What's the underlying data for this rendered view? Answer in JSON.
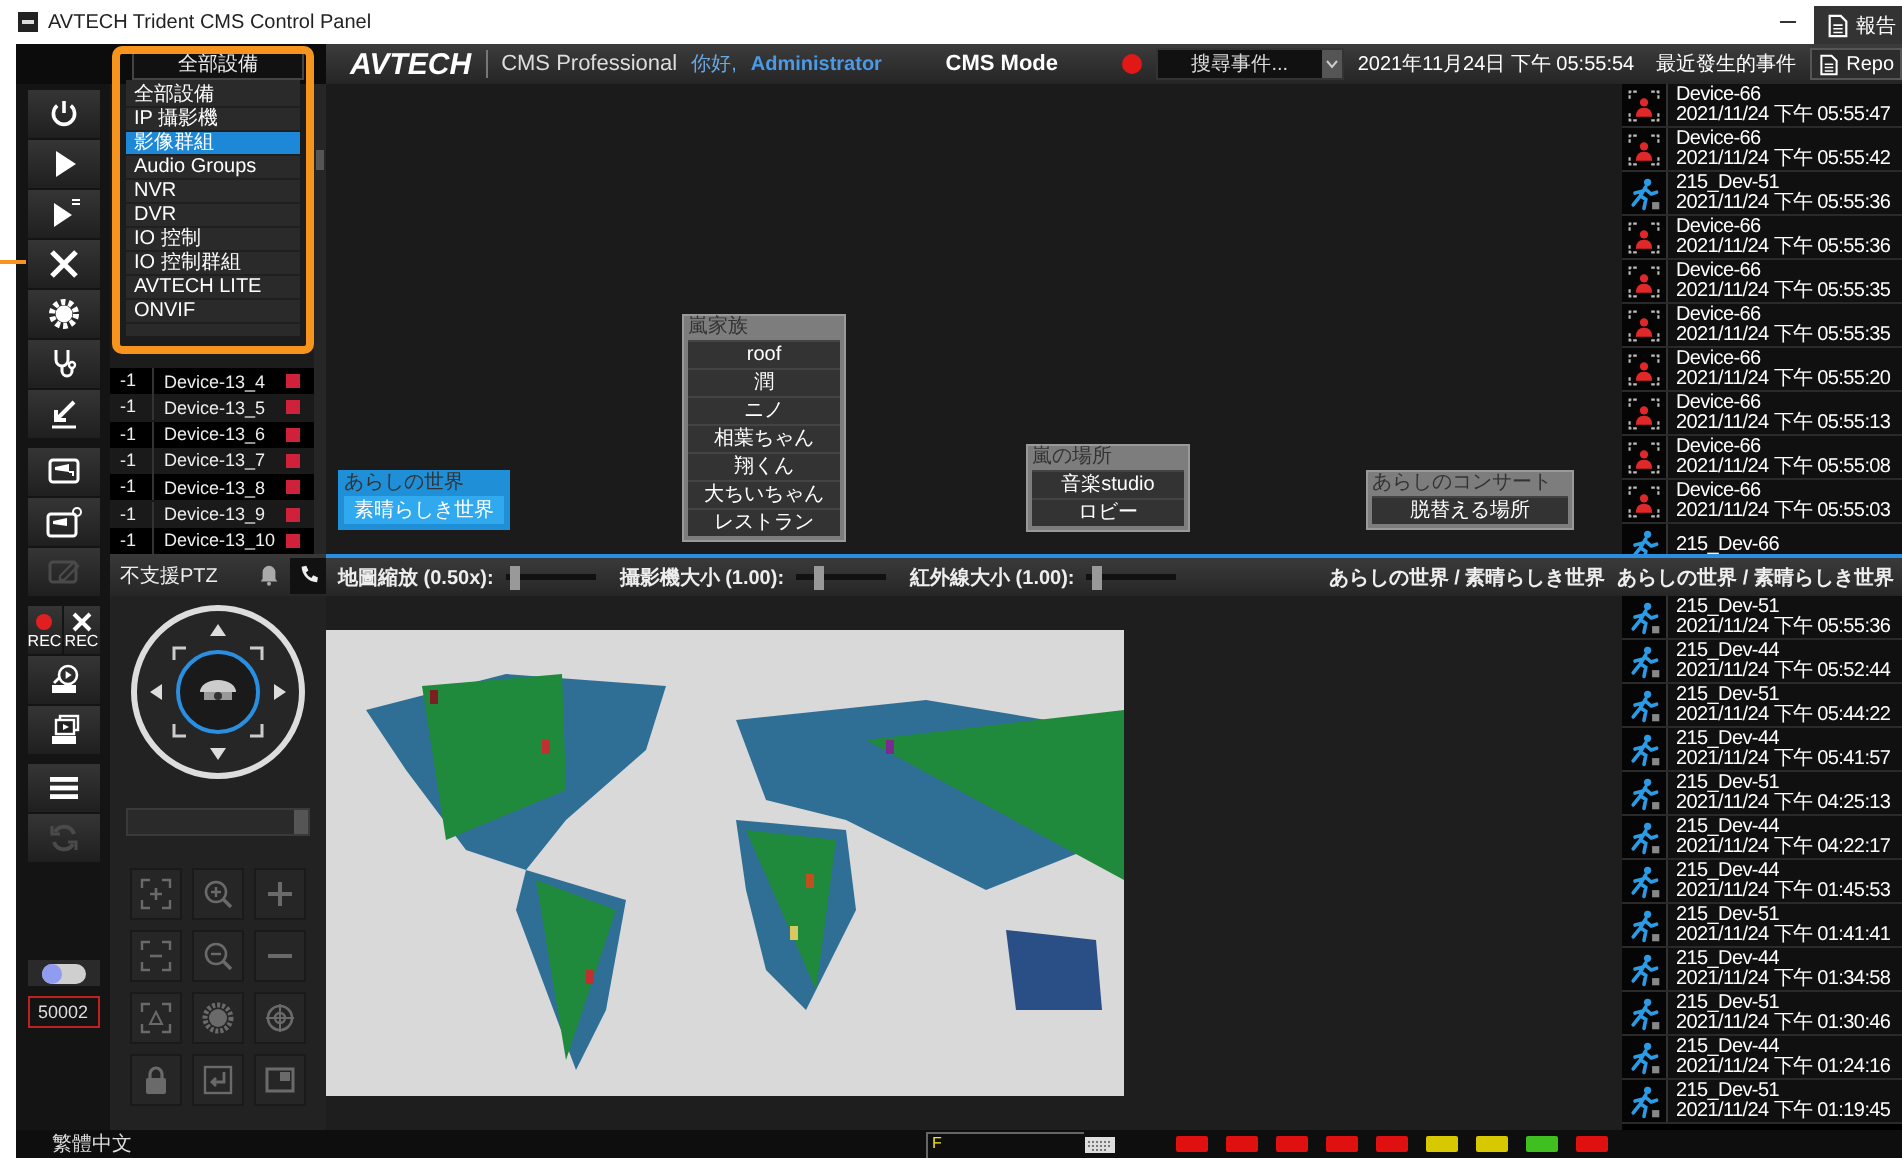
{
  "window": {
    "title": "AVTECH Trident CMS Control Panel"
  },
  "overlay_button": {
    "label": "報告"
  },
  "header": {
    "device_filter": "全部設備",
    "logo": "AVTECH",
    "product": "CMS Professional",
    "greeting": "你好,",
    "user": "Administrator",
    "mode": "CMS Mode",
    "event_search": "搜尋事件...",
    "datetime": "2021年11月24日 下午 05:55:54",
    "recent_events_title": "最近發生的事件",
    "report_button": "Repo"
  },
  "device_menu": [
    {
      "label": "全部設備",
      "selected": false
    },
    {
      "label": "IP 攝影機",
      "selected": false
    },
    {
      "label": "影像群組",
      "selected": true
    },
    {
      "label": "Audio Groups",
      "selected": false
    },
    {
      "label": "NVR",
      "selected": false
    },
    {
      "label": "DVR",
      "selected": false
    },
    {
      "label": "IO 控制",
      "selected": false
    },
    {
      "label": "IO 控制群組",
      "selected": false
    },
    {
      "label": "AVTECH LITE",
      "selected": false
    },
    {
      "label": "ONVIF",
      "selected": false
    }
  ],
  "toolbar_groups": [
    [
      {
        "kind": "power",
        "disabled": false
      },
      {
        "kind": "play",
        "disabled": false
      },
      {
        "kind": "multi-play",
        "disabled": false
      },
      {
        "kind": "tools",
        "disabled": false
      },
      {
        "kind": "gear",
        "disabled": false
      },
      {
        "kind": "stethoscope",
        "disabled": false
      },
      {
        "kind": "download",
        "disabled": false
      }
    ],
    [
      {
        "kind": "camera-monitor",
        "disabled": false
      },
      {
        "kind": "camera-monitor-gear",
        "disabled": false
      },
      {
        "kind": "camera-edit",
        "disabled": true
      }
    ],
    [
      {
        "kind": "rec",
        "label": "REC",
        "disabled": false
      },
      {
        "kind": "rec-tools",
        "label": "REC",
        "disabled": false
      },
      {
        "kind": "playback",
        "disabled": false
      },
      {
        "kind": "multi-playback",
        "disabled": false
      }
    ],
    [
      {
        "kind": "menu",
        "disabled": false
      },
      {
        "kind": "refresh",
        "disabled": true
      }
    ]
  ],
  "toggle": {
    "on": false
  },
  "port": "50002",
  "devices": [
    {
      "channel": "-1",
      "name": "Device-13_4"
    },
    {
      "channel": "-1",
      "name": "Device-13_5"
    },
    {
      "channel": "-1",
      "name": "Device-13_6"
    },
    {
      "channel": "-1",
      "name": "Device-13_7"
    },
    {
      "channel": "-1",
      "name": "Device-13_8"
    },
    {
      "channel": "-1",
      "name": "Device-13_9"
    },
    {
      "channel": "-1",
      "name": "Device-13_10"
    }
  ],
  "groups": [
    {
      "title": "あらしの世界",
      "selected": true,
      "items": [
        "素晴らしき世界"
      ]
    },
    {
      "title": "嵐家族",
      "selected": false,
      "items": [
        "roof",
        "潤",
        "ニノ",
        "相葉ちゃん",
        "翔くん",
        "大ちいちゃん",
        "レストラン"
      ]
    },
    {
      "title": "嵐の場所",
      "selected": false,
      "items": [
        "音楽studio",
        "ロビー"
      ]
    },
    {
      "title": "あらしのコンサート",
      "selected": false,
      "items": [
        "脱替える場所"
      ]
    }
  ],
  "ptz": {
    "status": "不支援PTZ"
  },
  "sliders": [
    {
      "label": "地圖縮放 (0.50x):",
      "level": 0.05
    },
    {
      "label": "攝影機大小 (1.00):",
      "level": 0.2
    },
    {
      "label": "紅外線大小 (1.00):",
      "level": 0.07
    }
  ],
  "breadcrumbs": [
    "あらしの世界 / 素晴らしき世界",
    "あらしの世界 / 素晴らしき世界"
  ],
  "events_top": [
    {
      "kind": "ivs",
      "device": "Device-66",
      "time": "2021/11/24 下午 05:55:47"
    },
    {
      "kind": "ivs",
      "device": "Device-66",
      "time": "2021/11/24 下午 05:55:42"
    },
    {
      "kind": "motion",
      "device": "215_Dev-51",
      "time": "2021/11/24 下午 05:55:36"
    },
    {
      "kind": "ivs",
      "device": "Device-66",
      "time": "2021/11/24 下午 05:55:36"
    },
    {
      "kind": "ivs",
      "device": "Device-66",
      "time": "2021/11/24 下午 05:55:35"
    },
    {
      "kind": "ivs",
      "device": "Device-66",
      "time": "2021/11/24 下午 05:55:35"
    },
    {
      "kind": "ivs",
      "device": "Device-66",
      "time": "2021/11/24 下午 05:55:20"
    },
    {
      "kind": "ivs",
      "device": "Device-66",
      "time": "2021/11/24 下午 05:55:13"
    },
    {
      "kind": "ivs",
      "device": "Device-66",
      "time": "2021/11/24 下午 05:55:08"
    },
    {
      "kind": "ivs",
      "device": "Device-66",
      "time": "2021/11/24 下午 05:55:03"
    },
    {
      "kind": "motion",
      "device": "215_Dev-66"
    }
  ],
  "events_bottom": [
    {
      "kind": "motion",
      "device": "215_Dev-51",
      "time": "2021/11/24 下午 05:55:36"
    },
    {
      "kind": "motion",
      "device": "215_Dev-44",
      "time": "2021/11/24 下午 05:52:44"
    },
    {
      "kind": "motion",
      "device": "215_Dev-51",
      "time": "2021/11/24 下午 05:44:22"
    },
    {
      "kind": "motion",
      "device": "215_Dev-44",
      "time": "2021/11/24 下午 05:41:57"
    },
    {
      "kind": "motion",
      "device": "215_Dev-51",
      "time": "2021/11/24 下午 04:25:13"
    },
    {
      "kind": "motion",
      "device": "215_Dev-44",
      "time": "2021/11/24 下午 04:22:17"
    },
    {
      "kind": "motion",
      "device": "215_Dev-44",
      "time": "2021/11/24 下午 01:45:53"
    },
    {
      "kind": "motion",
      "device": "215_Dev-51",
      "time": "2021/11/24 下午 01:41:41"
    },
    {
      "kind": "motion",
      "device": "215_Dev-44",
      "time": "2021/11/24 下午 01:34:58"
    },
    {
      "kind": "motion",
      "device": "215_Dev-51",
      "time": "2021/11/24 下午 01:30:46"
    },
    {
      "kind": "motion",
      "device": "215_Dev-44",
      "time": "2021/11/24 下午 01:24:16"
    },
    {
      "kind": "motion",
      "device": "215_Dev-51",
      "time": "2021/11/24 下午 01:19:45"
    }
  ],
  "status_bar": {
    "language": "繁體中文",
    "input_mode": "F",
    "indicators": [
      {
        "color": "#e01010"
      },
      {
        "color": "#e01010"
      },
      {
        "color": "#e01010"
      },
      {
        "color": "#e01010"
      },
      {
        "color": "#e01010"
      },
      {
        "color": "#d8c800"
      },
      {
        "color": "#d8c800"
      },
      {
        "color": "#40c020"
      },
      {
        "color": "#e01010"
      }
    ]
  }
}
